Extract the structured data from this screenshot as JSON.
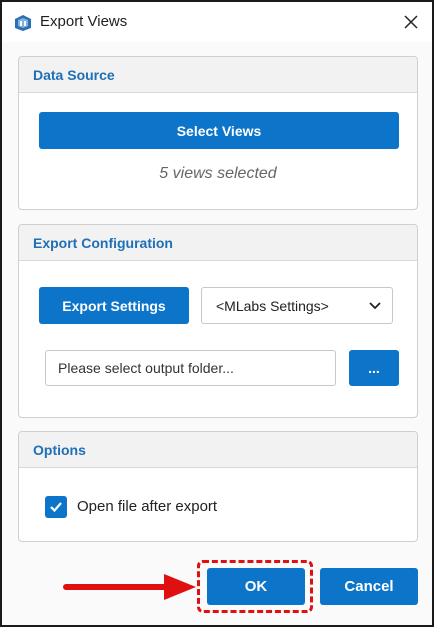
{
  "window": {
    "title": "Export Views",
    "app_icon": "mlabs-logo-icon",
    "close_icon": "close-icon"
  },
  "data_source": {
    "header": "Data Source",
    "select_views_label": "Select Views",
    "status_text": "5 views selected"
  },
  "export_configuration": {
    "header": "Export Configuration",
    "export_settings_label": "Export Settings",
    "settings_select_value": "<MLabs Settings>",
    "output_folder_value": "",
    "output_folder_placeholder": "Please select output folder...",
    "browse_label": "..."
  },
  "options": {
    "header": "Options",
    "open_file_label": "Open file after export",
    "open_file_checked": true
  },
  "footer": {
    "ok_label": "OK",
    "cancel_label": "Cancel"
  },
  "colors": {
    "accent": "#0c74c9",
    "header_text": "#1f6fb8",
    "annotation": "#e01010"
  }
}
